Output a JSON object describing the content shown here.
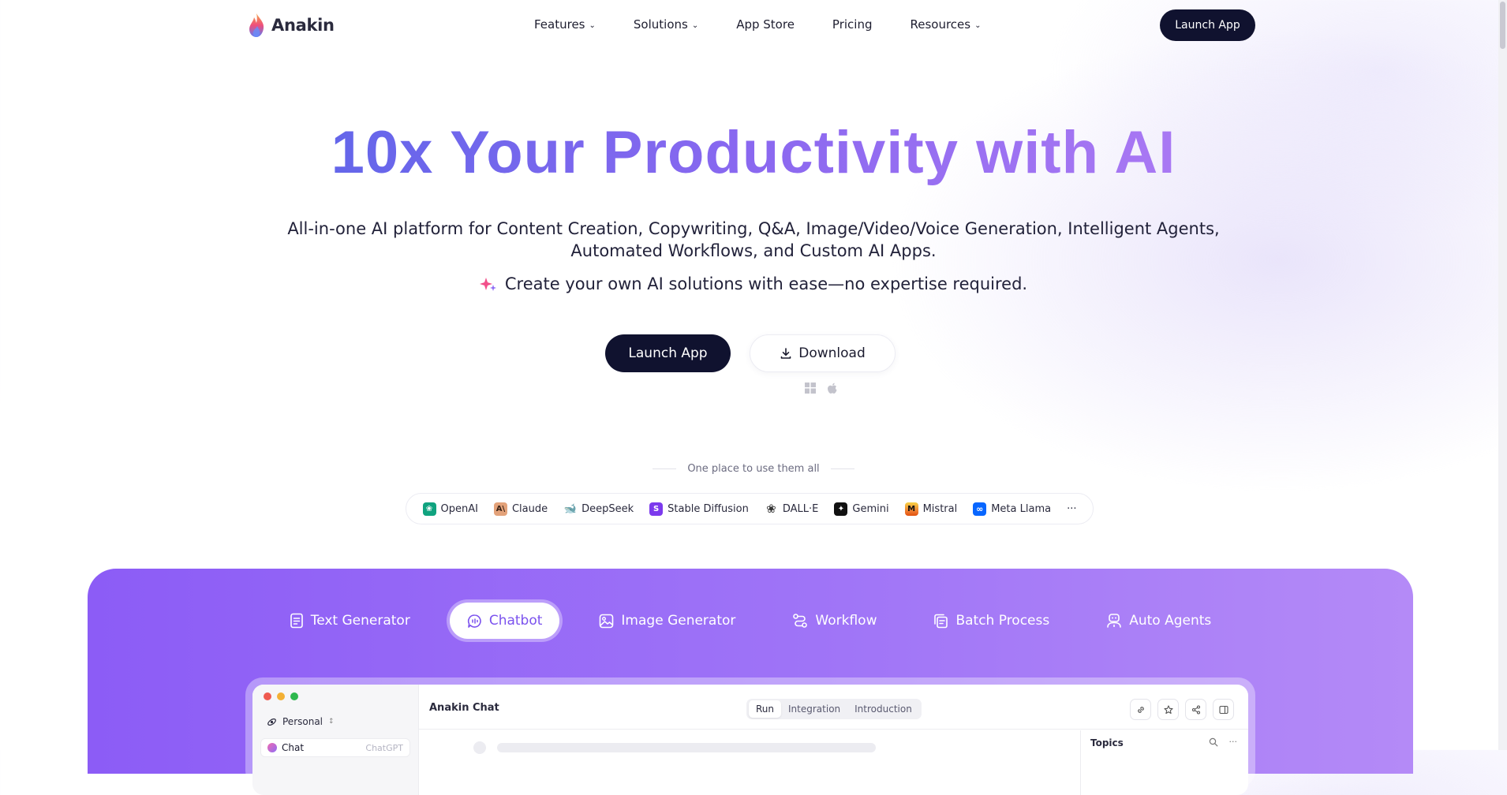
{
  "brand": {
    "name": "Anakin"
  },
  "nav": {
    "items": [
      {
        "label": "Features",
        "dropdown": true
      },
      {
        "label": "Solutions",
        "dropdown": true
      },
      {
        "label": "App Store",
        "dropdown": false
      },
      {
        "label": "Pricing",
        "dropdown": false
      },
      {
        "label": "Resources",
        "dropdown": true
      }
    ],
    "launch_label": "Launch App"
  },
  "hero": {
    "title": "10x Your Productivity with AI",
    "subtitle": "All-in-one AI platform for Content Creation, Copywriting, Q&A, Image/Video/Voice Generation, Intelligent Agents, Automated Workflows, and Custom AI Apps.",
    "tagline": "Create your own AI solutions with ease—no expertise required.",
    "launch_label": "Launch App",
    "download_label": "Download",
    "os_icons": [
      "windows-icon",
      "apple-icon"
    ]
  },
  "providers": {
    "heading": "One place to use them all",
    "items": [
      {
        "label": "OpenAI",
        "icon": "openai-icon",
        "color": "#10a37f"
      },
      {
        "label": "Claude",
        "icon": "claude-icon",
        "color": "#d9825b"
      },
      {
        "label": "DeepSeek",
        "icon": "deepseek-icon",
        "color": "#4d6bfe"
      },
      {
        "label": "Stable Diffusion",
        "icon": "stable-diffusion-icon",
        "color": "#7c3aed"
      },
      {
        "label": "DALL·E",
        "icon": "dalle-icon",
        "color": "#333333"
      },
      {
        "label": "Gemini",
        "icon": "gemini-icon",
        "color": "#111111"
      },
      {
        "label": "Mistral",
        "icon": "mistral-icon",
        "color": "#f7a21b"
      },
      {
        "label": "Meta Llama",
        "icon": "meta-icon",
        "color": "#0866ff"
      }
    ],
    "more_label": "···"
  },
  "showcase": {
    "tabs": [
      {
        "label": "Text Generator",
        "icon": "text-doc-icon",
        "active": false
      },
      {
        "label": "Chatbot",
        "icon": "chat-bubble-icon",
        "active": true
      },
      {
        "label": "Image Generator",
        "icon": "image-icon",
        "active": false
      },
      {
        "label": "Workflow",
        "icon": "workflow-icon",
        "active": false
      },
      {
        "label": "Batch Process",
        "icon": "batch-icon",
        "active": false
      },
      {
        "label": "Auto Agents",
        "icon": "agent-icon",
        "active": false
      }
    ],
    "app": {
      "workspace": "Personal",
      "sidebar_item": "Chat",
      "sidebar_item_model": "ChatGPT",
      "title": "Anakin Chat",
      "modes": [
        "Run",
        "Integration",
        "Introduction"
      ],
      "active_mode": "Run",
      "topics_title": "Topics"
    }
  },
  "colors": {
    "accent_dark": "#10122f",
    "title_gradient_start": "#6466ea",
    "title_gradient_end": "#a978f3",
    "showcase_purple": "#8c5cf6"
  }
}
